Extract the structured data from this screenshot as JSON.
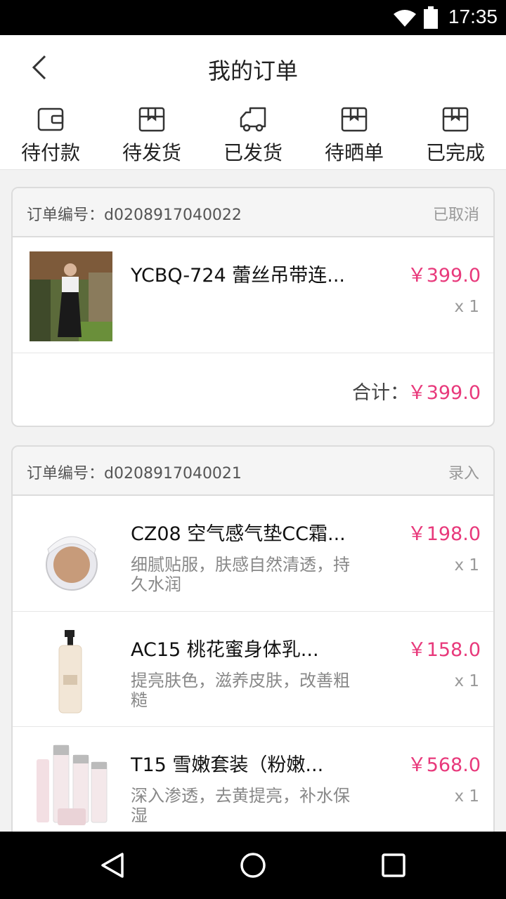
{
  "status_bar": {
    "time": "17:35"
  },
  "header": {
    "title": "我的订单"
  },
  "tabs": [
    {
      "label": "待付款",
      "icon": "wallet-icon"
    },
    {
      "label": "待发货",
      "icon": "box-icon"
    },
    {
      "label": "已发货",
      "icon": "truck-icon"
    },
    {
      "label": "待晒单",
      "icon": "box-icon"
    },
    {
      "label": "已完成",
      "icon": "box-icon"
    }
  ],
  "orders": [
    {
      "order_label": "订单编号：d0208917040022",
      "status": "已取消",
      "items": [
        {
          "name": "YCBQ-724 蕾丝吊带连...",
          "desc": "",
          "price": "￥399.0",
          "qty": "x 1"
        }
      ],
      "total_label": "合计：",
      "total_value": "￥399.0"
    },
    {
      "order_label": "订单编号：d0208917040021",
      "status": "录入",
      "items": [
        {
          "name": "CZ08 空气感气垫CC霜...",
          "desc": "细腻贴服，肤感自然清透，持久水润",
          "price": "￥198.0",
          "qty": "x 1"
        },
        {
          "name": "AC15 桃花蜜身体乳...",
          "desc": "提亮肤色，滋养皮肤，改善粗糙",
          "price": "￥158.0",
          "qty": "x 1"
        },
        {
          "name": "T15 雪嫩套装（粉嫩...",
          "desc": "深入渗透，去黄提亮，补水保湿",
          "price": "￥568.0",
          "qty": "x 1"
        }
      ]
    }
  ],
  "colors": {
    "price": "#e8397b",
    "status_bar": "#000000",
    "background": "#f2f2f2"
  }
}
